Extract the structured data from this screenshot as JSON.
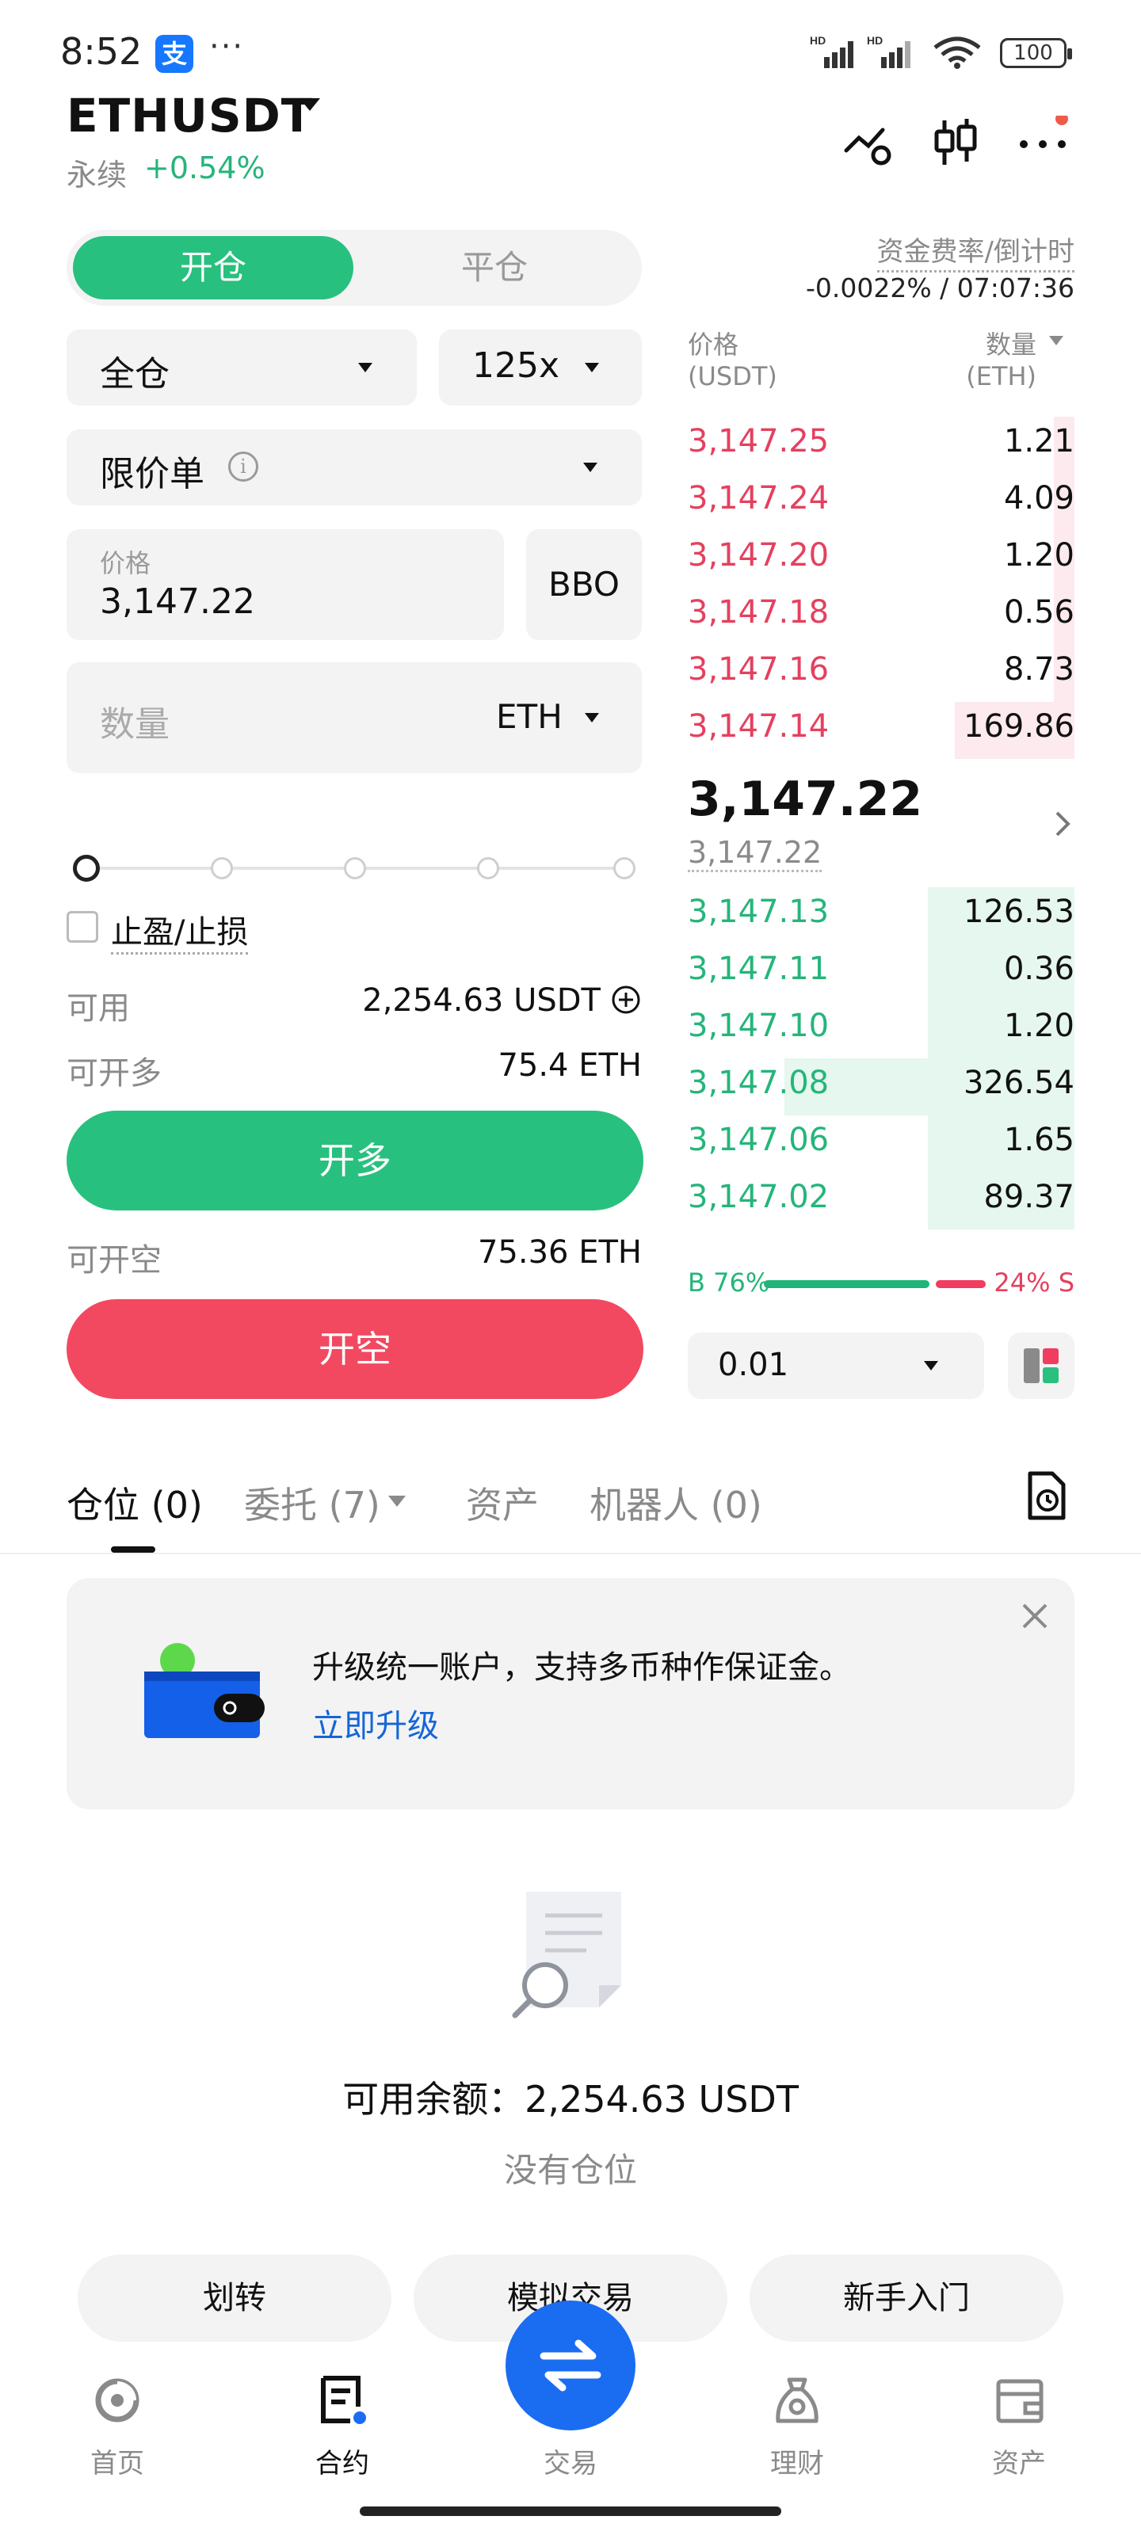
{
  "status_bar": {
    "time": "8:52",
    "app_badge": "支",
    "more": "···",
    "battery": "100",
    "network_labels": [
      "HD",
      "HD"
    ]
  },
  "header": {
    "symbol": "ETHUSDT",
    "contract_type": "永续",
    "change": "+0.54%"
  },
  "order_panel": {
    "tab_open": "开仓",
    "tab_close": "平仓",
    "margin_mode": "全仓",
    "leverage": "125x",
    "order_type": "限价单",
    "price_label": "价格",
    "price_value": "3,147.22",
    "bbo": "BBO",
    "qty_placeholder": "数量",
    "qty_unit": "ETH",
    "tpsl_label": "止盈/止损",
    "available_label": "可用",
    "available_value": "2,254.63 USDT",
    "max_long_label": "可开多",
    "max_long_value": "75.4 ETH",
    "long_button": "开多",
    "max_short_label": "可开空",
    "max_short_value": "75.36 ETH",
    "short_button": "开空"
  },
  "funding": {
    "label": "资金费率/倒计时",
    "value": "-0.0022% / 07:07:36"
  },
  "orderbook": {
    "price_header": "价格",
    "price_unit": "(USDT)",
    "qty_header": "数量",
    "qty_unit": "(ETH)",
    "asks": [
      {
        "price": "3,147.25",
        "qty": "1.21"
      },
      {
        "price": "3,147.24",
        "qty": "4.09"
      },
      {
        "price": "3,147.20",
        "qty": "1.20"
      },
      {
        "price": "3,147.18",
        "qty": "0.56"
      },
      {
        "price": "3,147.16",
        "qty": "8.73"
      },
      {
        "price": "3,147.14",
        "qty": "169.86"
      }
    ],
    "last_price": "3,147.22",
    "mark_price": "3,147.22",
    "bids": [
      {
        "price": "3,147.13",
        "qty": "126.53"
      },
      {
        "price": "3,147.11",
        "qty": "0.36"
      },
      {
        "price": "3,147.10",
        "qty": "1.20"
      },
      {
        "price": "3,147.08",
        "qty": "326.54"
      },
      {
        "price": "3,147.06",
        "qty": "1.65"
      },
      {
        "price": "3,147.02",
        "qty": "89.37"
      }
    ],
    "buy_ratio_label": "B 76%",
    "sell_ratio_label": "24% S",
    "buy_ratio": 0.76,
    "precision": "0.01"
  },
  "position_tabs": [
    {
      "label": "仓位 (0)"
    },
    {
      "label": "委托 (7)"
    },
    {
      "label": "资产"
    },
    {
      "label": "机器人 (0)"
    }
  ],
  "upgrade_card": {
    "text": "升级统一账户，支持多币种作保证金。",
    "link": "立即升级"
  },
  "empty_state": {
    "balance": "可用余额：2,254.63 USDT",
    "message": "没有仓位"
  },
  "quick_actions": [
    "划转",
    "模拟交易",
    "新手入门"
  ],
  "bottom_nav": [
    {
      "label": "首页"
    },
    {
      "label": "合约"
    },
    {
      "label": "交易"
    },
    {
      "label": "理财"
    },
    {
      "label": "资产"
    }
  ],
  "colors": {
    "green": "#28c07e",
    "red": "#f24961",
    "blue": "#1a6cf1",
    "link": "#1466d6"
  }
}
